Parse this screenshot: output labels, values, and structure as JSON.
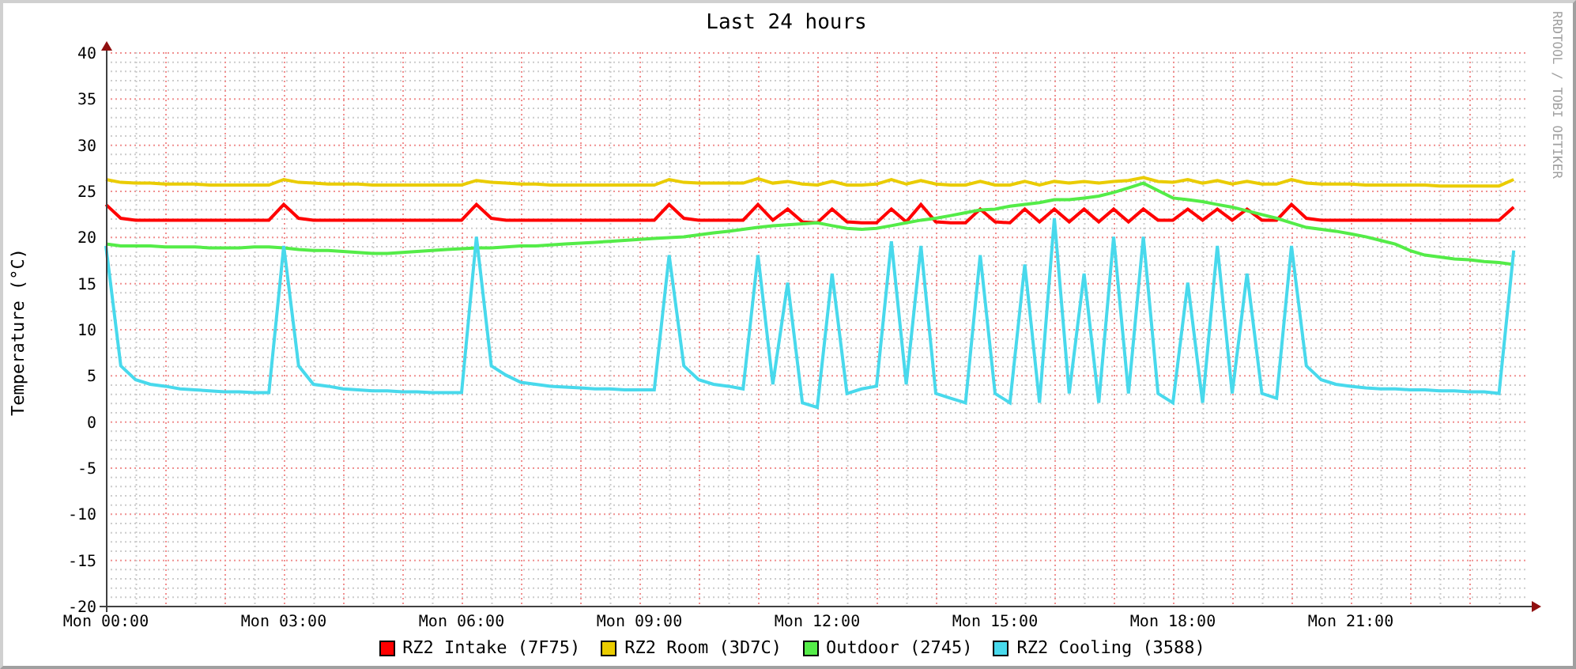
{
  "graph": {
    "credit": "RRDTOOL / TOBI OETIKER",
    "chart_data": {
      "type": "line",
      "title": "Last 24 hours",
      "ylabel": "Temperature (°C)",
      "categories": [
        "Mon 00:00",
        null,
        null,
        null,
        null,
        null,
        null,
        null,
        null,
        null,
        null,
        null,
        "Mon 03:00",
        null,
        null,
        null,
        null,
        null,
        null,
        null,
        null,
        null,
        null,
        null,
        "Mon 06:00",
        null,
        null,
        null,
        null,
        null,
        null,
        null,
        null,
        null,
        null,
        null,
        "Mon 09:00",
        null,
        null,
        null,
        null,
        null,
        null,
        null,
        null,
        null,
        null,
        null,
        "Mon 12:00",
        null,
        null,
        null,
        null,
        null,
        null,
        null,
        null,
        null,
        null,
        null,
        "Mon 15:00",
        null,
        null,
        null,
        null,
        null,
        null,
        null,
        null,
        null,
        null,
        null,
        "Mon 18:00",
        null,
        null,
        null,
        null,
        null,
        null,
        null,
        null,
        null,
        null,
        null,
        "Mon 21:00",
        null,
        null,
        null,
        null,
        null,
        null,
        null,
        null,
        null,
        null,
        null
      ],
      "series": [
        {
          "name": "RZ2 Intake (7F75)",
          "color": "#ff0000",
          "values": [
            23.5,
            22,
            21.8,
            21.8,
            21.8,
            21.8,
            21.8,
            21.8,
            21.8,
            21.8,
            21.8,
            21.8,
            23.5,
            22,
            21.8,
            21.8,
            21.8,
            21.8,
            21.8,
            21.8,
            21.8,
            21.8,
            21.8,
            21.8,
            21.8,
            23.5,
            22,
            21.8,
            21.8,
            21.8,
            21.8,
            21.8,
            21.8,
            21.8,
            21.8,
            21.8,
            21.8,
            21.8,
            23.5,
            22,
            21.8,
            21.8,
            21.8,
            21.8,
            23.5,
            21.8,
            23,
            21.6,
            21.5,
            23,
            21.6,
            21.5,
            21.5,
            23,
            21.6,
            23.5,
            21.6,
            21.5,
            21.5,
            23,
            21.6,
            21.5,
            23,
            21.6,
            23,
            21.6,
            23,
            21.6,
            23,
            21.6,
            23,
            21.8,
            21.8,
            23,
            21.8,
            23,
            21.8,
            23,
            21.8,
            21.8,
            23.5,
            22,
            21.8,
            21.8,
            21.8,
            21.8,
            21.8,
            21.8,
            21.8,
            21.8,
            21.8,
            21.8,
            21.8,
            21.8,
            21.8,
            23.2
          ]
        },
        {
          "name": "RZ2 Room (3D7C)",
          "color": "#eacc00",
          "values": [
            26.2,
            25.9,
            25.8,
            25.8,
            25.7,
            25.7,
            25.7,
            25.6,
            25.6,
            25.6,
            25.6,
            25.6,
            26.2,
            25.9,
            25.8,
            25.7,
            25.7,
            25.7,
            25.6,
            25.6,
            25.6,
            25.6,
            25.6,
            25.6,
            25.6,
            26.1,
            25.9,
            25.8,
            25.7,
            25.7,
            25.6,
            25.6,
            25.6,
            25.6,
            25.6,
            25.6,
            25.6,
            25.6,
            26.2,
            25.9,
            25.8,
            25.8,
            25.8,
            25.8,
            26.3,
            25.8,
            26,
            25.7,
            25.6,
            26,
            25.6,
            25.6,
            25.7,
            26.2,
            25.7,
            26.1,
            25.7,
            25.6,
            25.6,
            26,
            25.6,
            25.6,
            26,
            25.6,
            26,
            25.8,
            26,
            25.8,
            26,
            26.1,
            26.4,
            26,
            25.9,
            26.2,
            25.8,
            26.1,
            25.7,
            26,
            25.7,
            25.7,
            26.2,
            25.8,
            25.7,
            25.7,
            25.7,
            25.6,
            25.6,
            25.6,
            25.6,
            25.6,
            25.5,
            25.5,
            25.5,
            25.5,
            25.5,
            26.2
          ]
        },
        {
          "name": "Outdoor (2745)",
          "color": "#54ec48",
          "values": [
            19.2,
            19,
            19,
            19,
            18.9,
            18.9,
            18.9,
            18.8,
            18.8,
            18.8,
            18.9,
            18.9,
            18.8,
            18.6,
            18.5,
            18.5,
            18.4,
            18.3,
            18.2,
            18.2,
            18.3,
            18.4,
            18.5,
            18.6,
            18.7,
            18.8,
            18.8,
            18.9,
            19,
            19,
            19.1,
            19.2,
            19.3,
            19.4,
            19.5,
            19.6,
            19.7,
            19.8,
            19.9,
            20,
            20.2,
            20.4,
            20.6,
            20.8,
            21,
            21.2,
            21.3,
            21.4,
            21.5,
            21.2,
            20.9,
            20.8,
            20.9,
            21.2,
            21.5,
            21.8,
            22,
            22.3,
            22.6,
            22.9,
            23,
            23.3,
            23.5,
            23.7,
            24,
            24,
            24.2,
            24.4,
            24.8,
            25.3,
            25.8,
            25,
            24.2,
            24,
            23.8,
            23.5,
            23.2,
            22.8,
            22.4,
            22,
            21.5,
            21,
            20.8,
            20.6,
            20.3,
            20,
            19.6,
            19.2,
            18.5,
            18,
            17.8,
            17.6,
            17.5,
            17.3,
            17.2,
            17
          ]
        },
        {
          "name": "RZ2 Cooling (3588)",
          "color": "#48d9ec",
          "values": [
            19,
            6,
            4.5,
            4,
            3.8,
            3.5,
            3.4,
            3.3,
            3.2,
            3.2,
            3.1,
            3.1,
            19,
            6,
            4,
            3.8,
            3.5,
            3.4,
            3.3,
            3.3,
            3.2,
            3.2,
            3.1,
            3.1,
            3.1,
            20,
            6,
            5,
            4.2,
            4,
            3.8,
            3.7,
            3.6,
            3.5,
            3.5,
            3.4,
            3.4,
            3.4,
            18,
            6,
            4.5,
            4,
            3.8,
            3.5,
            18,
            4,
            15,
            2,
            1.5,
            16,
            3,
            3.5,
            3.8,
            19.5,
            4,
            19,
            3,
            2.5,
            2,
            18,
            3,
            2,
            17,
            2,
            22,
            3,
            16,
            2,
            20,
            3,
            20,
            3,
            2,
            15,
            2,
            19,
            3,
            16,
            3,
            2.5,
            19,
            6,
            4.5,
            4,
            3.8,
            3.6,
            3.5,
            3.5,
            3.4,
            3.4,
            3.3,
            3.3,
            3.2,
            3.2,
            3,
            18.5
          ]
        }
      ],
      "ylim": [
        -20,
        40
      ],
      "grid": true,
      "yticks": [
        -20,
        -15,
        -10,
        -5,
        0,
        5,
        10,
        15,
        20,
        25,
        30,
        35,
        40
      ]
    }
  }
}
